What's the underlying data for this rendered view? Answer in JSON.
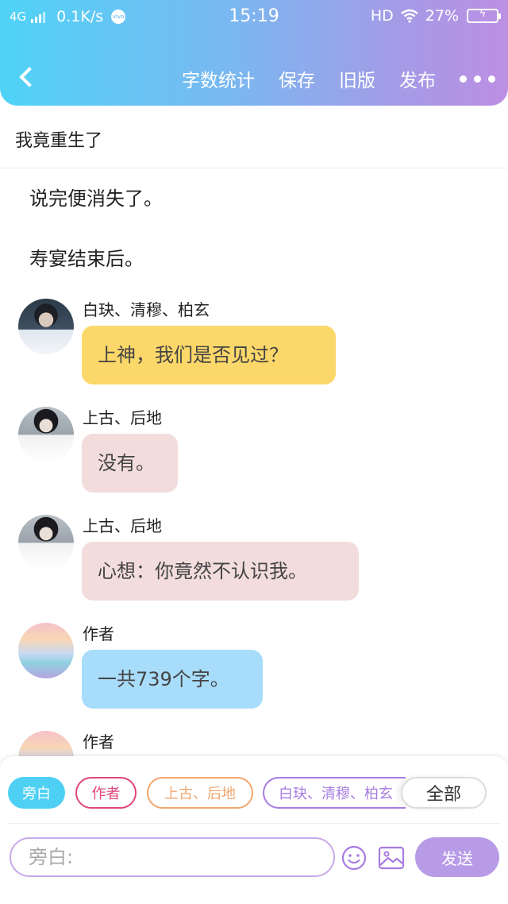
{
  "status_bar": {
    "network": "4G",
    "speed": "0.1K/s",
    "time": "15:19",
    "hd": "HD",
    "battery": "27%"
  },
  "nav": {
    "back_label": "",
    "actions": [
      "字数统计",
      "保存",
      "旧版",
      "发布"
    ],
    "more_icon": "more-dots-icon"
  },
  "title": "我竟重生了",
  "narrations": [
    "说完便消失了。",
    "寿宴结束后。"
  ],
  "messages": [
    {
      "speaker": "白玦、清穆、柏玄",
      "text": "上神，我们是否见过？",
      "bubble_color": "#fcd86a",
      "avatar": "man-avatar"
    },
    {
      "speaker": "上古、后地",
      "text": "没有。",
      "bubble_color": "#f2dcdc",
      "avatar": "woman-avatar"
    },
    {
      "speaker": "上古、后地",
      "text": "心想：你竟然不认识我。",
      "bubble_color": "#f2dcdc",
      "avatar": "woman-avatar"
    },
    {
      "speaker": "作者",
      "text": "一共739个字。",
      "bubble_color": "#a8dcfb",
      "avatar": "author-avatar"
    },
    {
      "speaker": "作者",
      "text": "",
      "bubble_color": "#a8dcfb",
      "avatar": "author-avatar"
    }
  ],
  "roles": {
    "panbai": "旁白",
    "author": "作者",
    "shanggu": "上古、后地",
    "baijue": "白玦、清穆、柏玄",
    "all": "全部"
  },
  "input": {
    "placeholder": "旁白:",
    "value": ""
  },
  "send_label": "发送",
  "colors": {
    "accent_blue": "#4dd0f4",
    "accent_purple": "#b89be6",
    "author_chip": "#e0457f",
    "shanggu_chip": "#f0a66e",
    "baijue_chip": "#a77ce0"
  }
}
